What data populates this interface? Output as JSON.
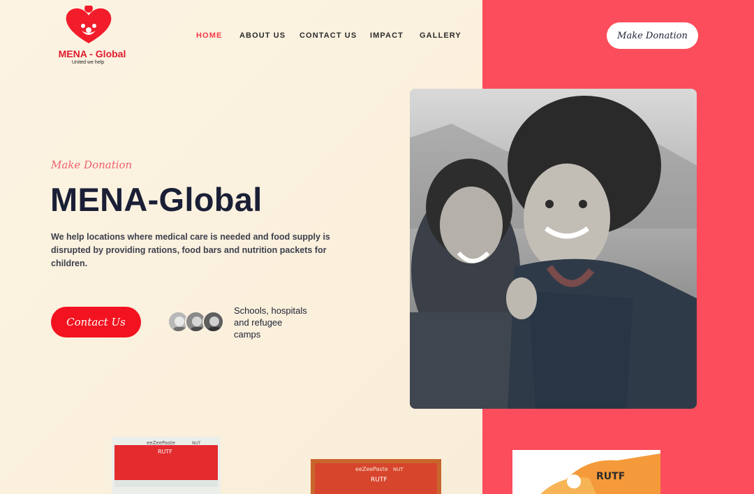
{
  "brand": {
    "name": "MENA - Global",
    "tagline": "United we help",
    "color": "#e01a2b"
  },
  "nav": {
    "items": [
      {
        "label": "HOME",
        "active": true
      },
      {
        "label": "ABOUT US",
        "active": false
      },
      {
        "label": "CONTACT US",
        "active": false
      },
      {
        "label": "IMPACT",
        "active": false
      },
      {
        "label": "GALLERY",
        "active": false
      }
    ],
    "donate_label": "Make Donation"
  },
  "hero": {
    "eyebrow": "Make Donation",
    "title": "MENA-Global",
    "description": "We help locations where medical care is needed and food supply is disrupted by providing rations, food bars and nutrition packets for children.",
    "contact_label": "Contact Us",
    "audience_text": "Schools, hospitals and refugee camps",
    "photo_icon": "children-photo"
  },
  "products": {
    "item1": {
      "brand": "eeZeePaste",
      "variant": "NUT",
      "name": "RUTF"
    },
    "item2": {
      "brand": "eeZeePaste",
      "variant": "NUT",
      "name": "RUTF"
    },
    "item3": {
      "name": "RUTF"
    }
  },
  "colors": {
    "accent": "#f3121f",
    "panel": "#fb4d5b",
    "background": "#fbf1df",
    "heading": "#1a1f36"
  }
}
